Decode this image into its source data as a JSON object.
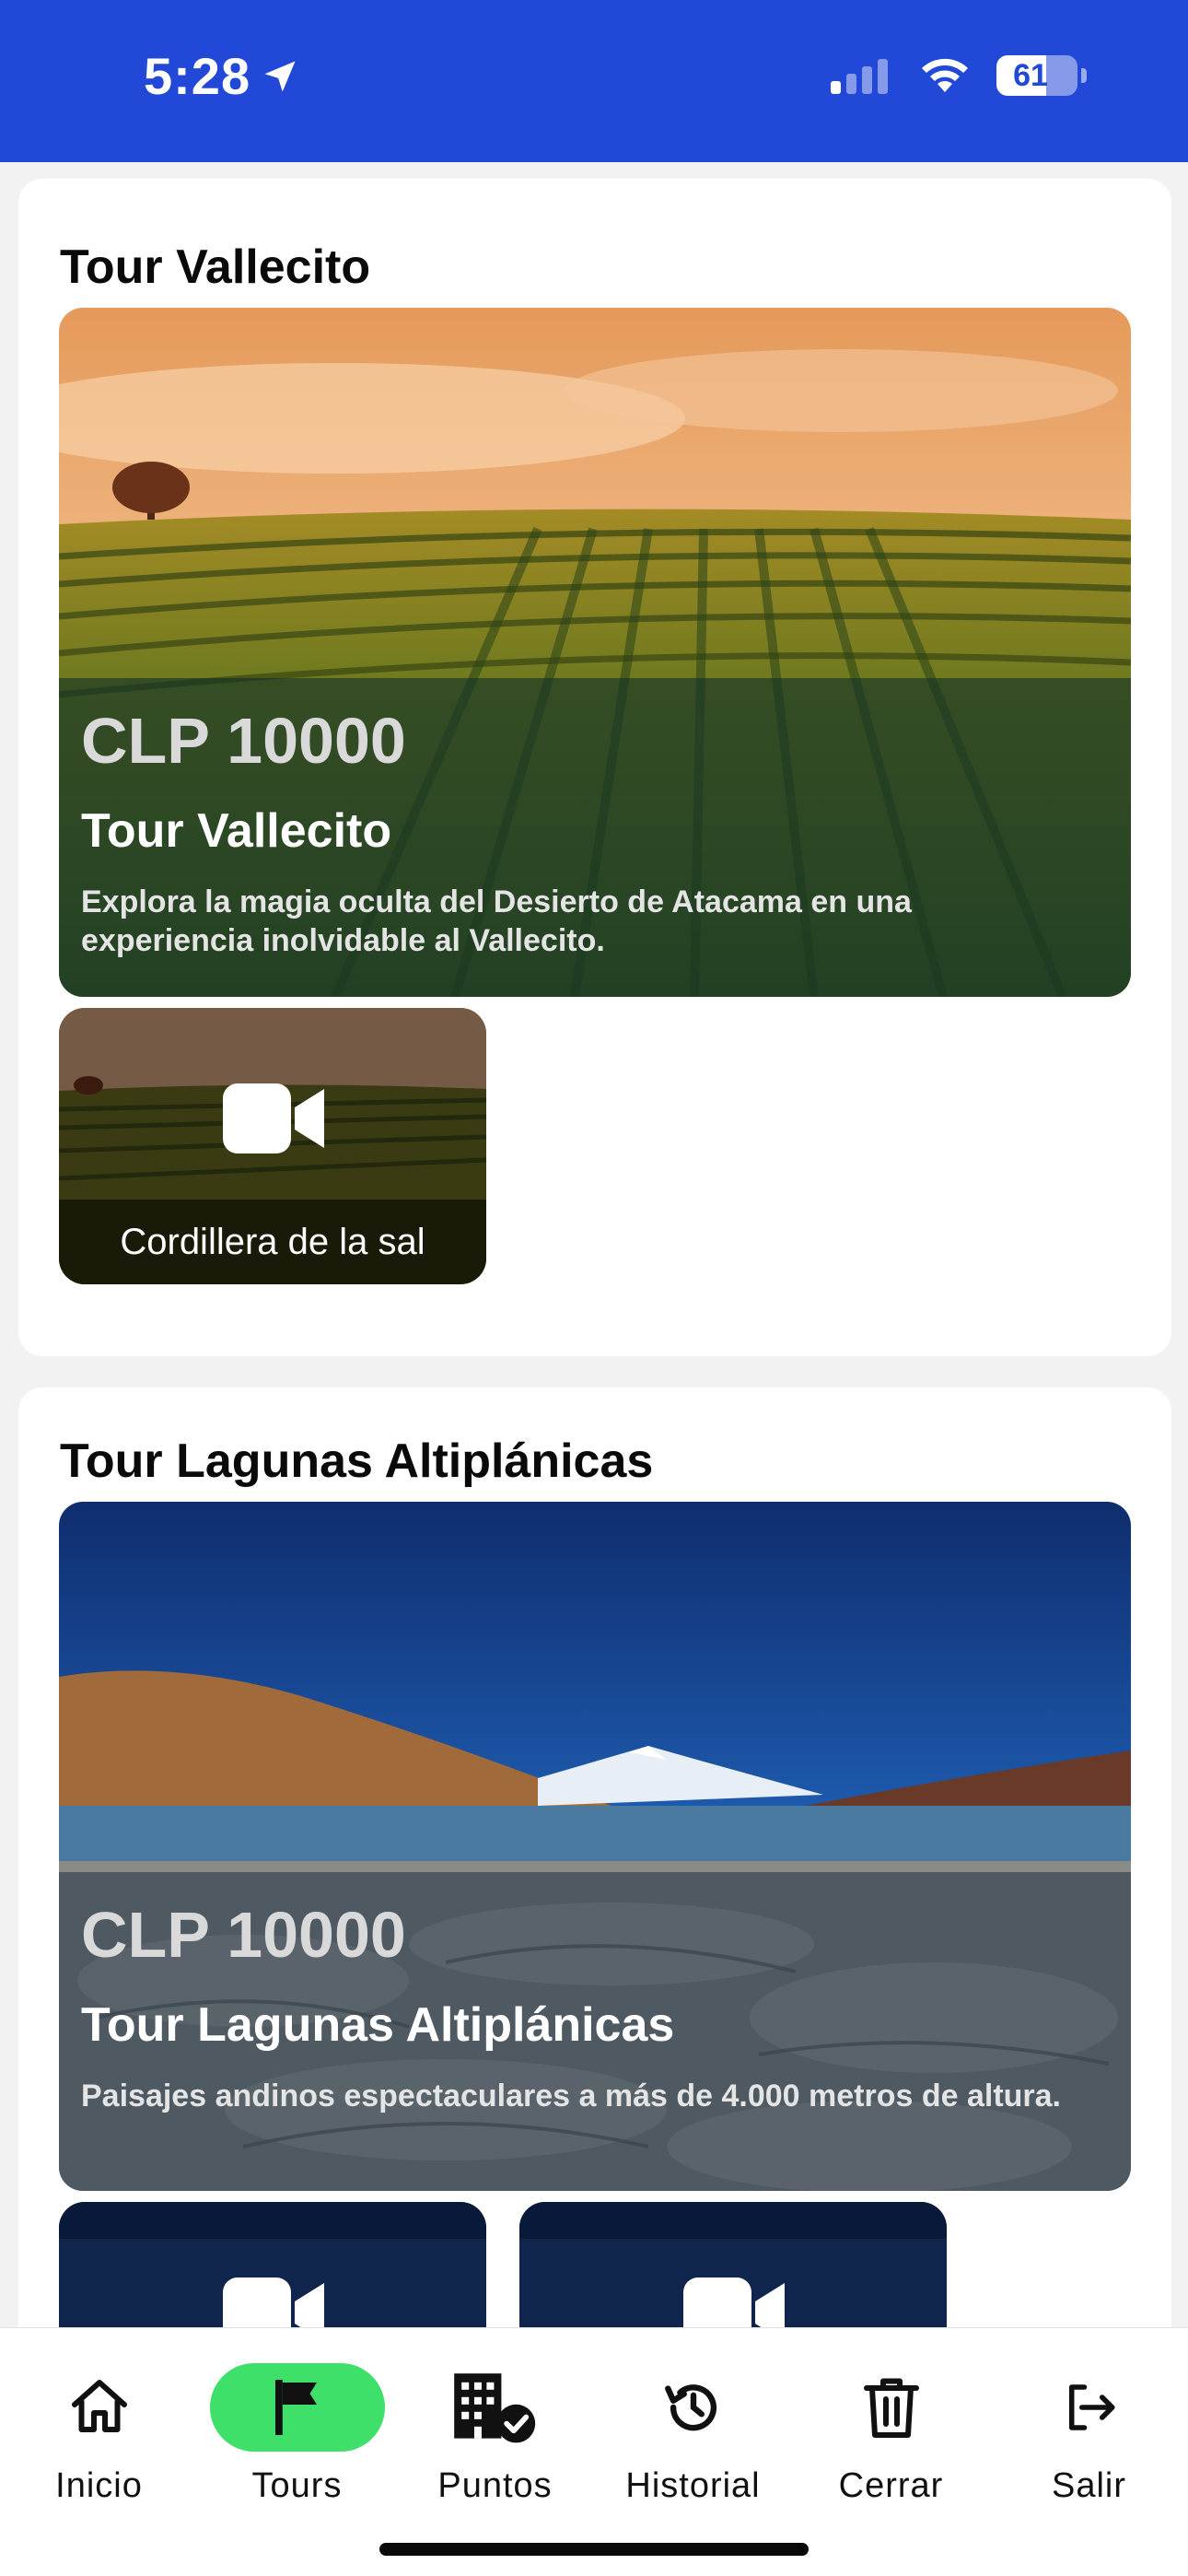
{
  "status_bar": {
    "time": "5:28",
    "battery_level": "61",
    "battery_fraction": 0.61,
    "signal_bars_active": 1,
    "background_color": "#2148d6"
  },
  "tours": [
    {
      "section_title": "Tour Vallecito",
      "price": "CLP 10000",
      "name": "Tour Vallecito",
      "description": "Explora la magia oculta del Desierto de Atacama en una experiencia inolvidable al Vallecito.",
      "videos": [
        {
          "label": "Cordillera de la sal",
          "icon": "video-camera-icon"
        }
      ]
    },
    {
      "section_title": "Tour Lagunas Altiplánicas",
      "price": "CLP 10000",
      "name": "Tour Lagunas Altiplánicas",
      "description": "Paisajes andinos espectaculares a más de 4.000 metros de altura.",
      "videos": [
        {
          "label": "",
          "icon": "video-camera-icon"
        },
        {
          "label": "",
          "icon": "video-camera-icon"
        }
      ]
    }
  ],
  "bottom_nav": {
    "active_color": "#3ee06a",
    "items": [
      {
        "label": "Inicio",
        "icon": "home-icon",
        "active": false
      },
      {
        "label": "Tours",
        "icon": "flag-icon",
        "active": true
      },
      {
        "label": "Puntos",
        "icon": "building-check-icon",
        "active": false
      },
      {
        "label": "Historial",
        "icon": "history-icon",
        "active": false
      },
      {
        "label": "Cerrar",
        "icon": "trash-icon",
        "active": false
      },
      {
        "label": "Salir",
        "icon": "logout-icon",
        "active": false
      }
    ]
  }
}
